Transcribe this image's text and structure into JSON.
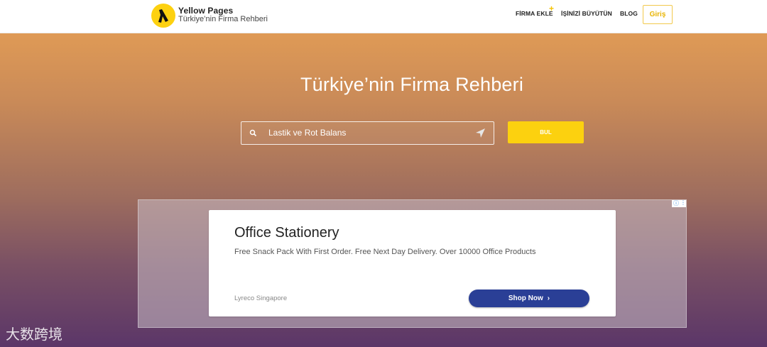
{
  "header": {
    "brand_name": "Yellow Pages",
    "brand_sub": "Türkiye’nin Firma Rehberi",
    "nav": {
      "firma_ekle": "FİRMA EKLE",
      "firma_ekle_badge": "+",
      "isinizi": "İŞİNİZİ BÜYÜTÜN",
      "blog": "BLOG"
    },
    "login": "Giriş"
  },
  "hero": {
    "title": "Türkiye’nin Firma Rehberi",
    "search_value": "Lastik ve Rot Balans",
    "find_button": "BUL"
  },
  "ad": {
    "title": "Office Stationery",
    "description": "Free Snack Pack With First Order. Free Next Day Delivery. Over 10000 Office Products",
    "advertiser": "Lyreco Singapore",
    "cta": "Shop Now",
    "cta_chevron": "›",
    "info_icon": "ⓘ",
    "menu_icon": "⋮"
  },
  "watermark": "大数跨境",
  "colors": {
    "brand_yellow": "#fcd10f",
    "ad_button": "#2a3f96"
  }
}
